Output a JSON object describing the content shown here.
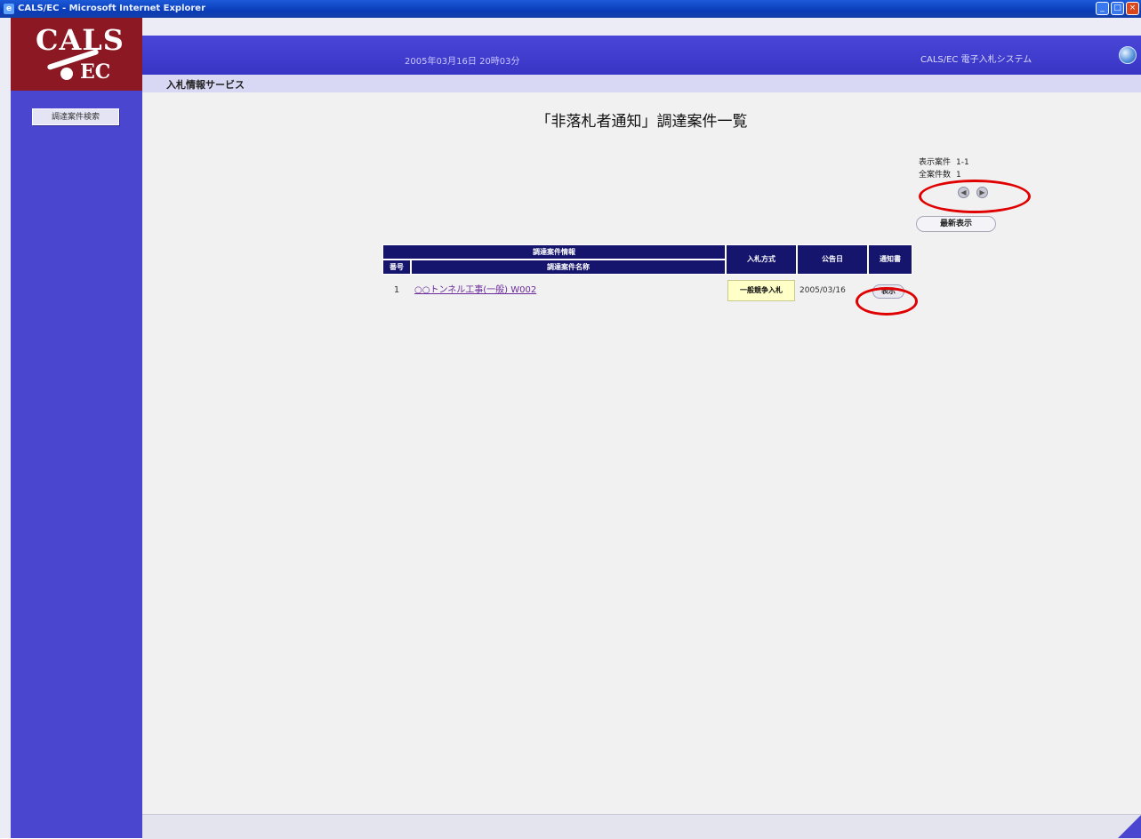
{
  "window": {
    "title": "CALS/EC - Microsoft Internet Explorer",
    "minimize": "_",
    "maximize": "□",
    "close": "×"
  },
  "logo": {
    "line1": "CALS",
    "line2": "EC"
  },
  "header": {
    "datetime": "2005年03月16日 20時03分",
    "system_name": "CALS/EC 電子入札システム"
  },
  "subtab": {
    "label": "入札情報サービス"
  },
  "sidebar": {
    "button_label": "調達案件検索"
  },
  "main": {
    "title": "「非落札者通知」調達案件一覧",
    "pager": {
      "display_label": "表示案件",
      "display_value": "1-1",
      "total_label": "全案件数",
      "total_value": "1",
      "prev": "◀",
      "next": "▶"
    },
    "refresh_button": "最新表示"
  },
  "table": {
    "group_header": "調達案件情報",
    "col_no": "番号",
    "col_name": "調達案件名称",
    "col_method": "入札方式",
    "col_date": "公告日",
    "col_notice": "通知書",
    "rows": [
      {
        "no": "1",
        "name": "○○トンネル工事(一般) W002",
        "method": "一般競争入札",
        "date": "2005/03/16",
        "notice_button": "表示"
      }
    ]
  }
}
